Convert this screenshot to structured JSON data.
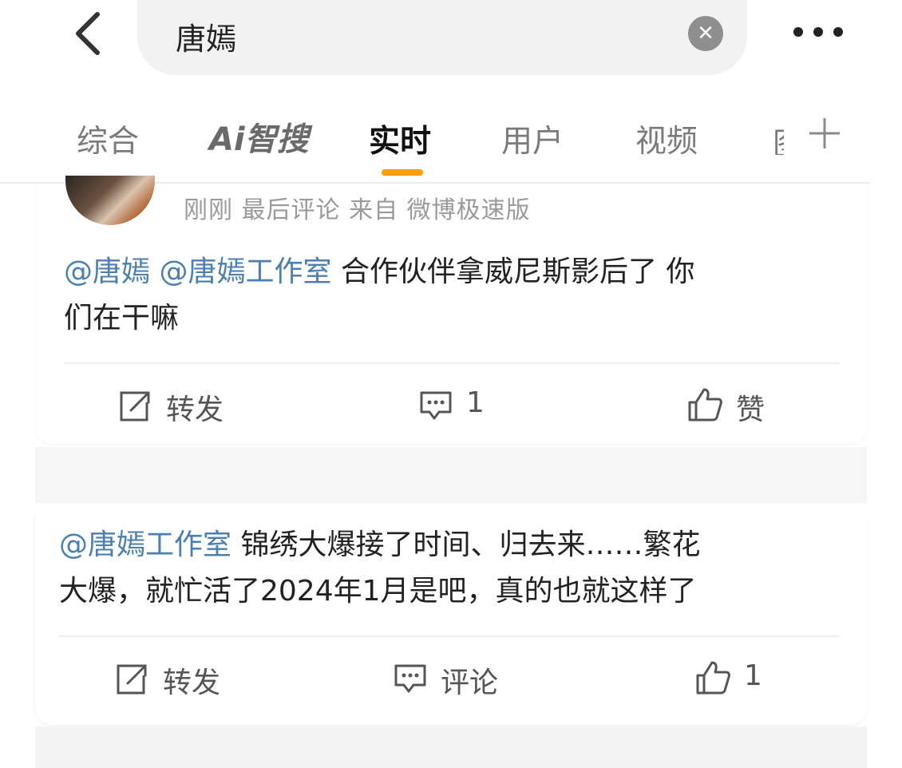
{
  "search": {
    "query": "唐嫣"
  },
  "tabs": [
    {
      "label": "综合"
    },
    {
      "label": "Ai智搜"
    },
    {
      "label": "实时"
    },
    {
      "label": "用户"
    },
    {
      "label": "视频"
    }
  ],
  "active_tab": "实时",
  "posts": [
    {
      "meta": "刚刚 最后评论  来自 微博极速版",
      "mentions": [
        "@唐嫣",
        "@唐嫣工作室"
      ],
      "text_line1": "合作伙伴拿威尼斯影后了 你",
      "text_line2": "们在干嘛",
      "repost_label": "转发",
      "comment_label": "1",
      "like_label": "赞"
    },
    {
      "mention": "@唐嫣工作室",
      "text_line1": "锦绣大爆接了时间、归去来……繁花",
      "text_line2": "大爆，就忙活了2024年1月是吧，真的也就这样了",
      "repost_label": "转发",
      "comment_label": "评论",
      "like_label": "1"
    }
  ],
  "colors": {
    "accent": "#ff9e0d",
    "mention": "#4a7fb0",
    "muted": "#9a9a9a"
  },
  "icons": [
    "back-arrow-icon",
    "clear-icon",
    "more-icon",
    "plus-icon",
    "repost-icon",
    "comment-icon",
    "like-icon"
  ]
}
